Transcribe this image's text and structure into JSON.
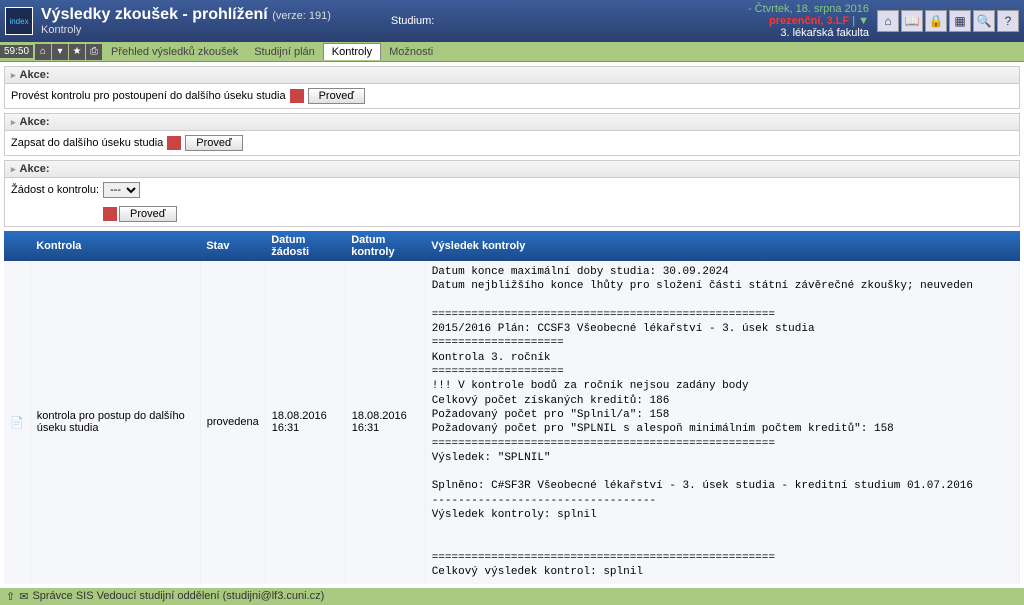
{
  "header": {
    "title": "Výsledky zkoušek - prohlížení",
    "version": "(verze: 191)",
    "subtitle": "Kontroly",
    "studium_label": "Studium:",
    "date": "- Čtvrtek, 18. srpna 2016",
    "context": "prezenční, 3.LF",
    "faculty": "3. lékařská fakulta"
  },
  "menubar": {
    "time": "59:50",
    "items": [
      {
        "label": "Přehled výsledků zkoušek",
        "active": false
      },
      {
        "label": "Studijní plán",
        "active": false
      },
      {
        "label": "Kontroly",
        "active": true
      },
      {
        "label": "Možnosti",
        "active": false
      }
    ]
  },
  "panels": {
    "a1": {
      "header": "Akce:",
      "text": "Provést kontrolu pro postoupení do dalšího úseku studia",
      "button": "Proveď"
    },
    "a2": {
      "header": "Akce:",
      "text": "Zapsat do dalšího úseku studia",
      "button": "Proveď"
    },
    "a3": {
      "header": "Akce:",
      "label": "Žádost o kontrolu:",
      "select_value": "---",
      "button": "Proveď"
    }
  },
  "table": {
    "headers": {
      "c1": "Kontrola",
      "c2": "Stav",
      "c3": "Datum žádosti",
      "c4": "Datum kontroly",
      "c5": "Výsledek kontroly"
    },
    "row": {
      "kontrola": "kontrola pro postup do dalšího úseku studia",
      "stav": "provedena",
      "datum_zadosti": "18.08.2016 16:31",
      "datum_kontroly": "18.08.2016 16:31",
      "vysledek": "Datum konce maximální doby studia: 30.09.2024\nDatum nejbližšího konce lhůty pro složení části státní závěrečné zkoušky; neuveden\n\n====================================================\n2015/2016 Plán: CCSF3 Všeobecné lékařství - 3. úsek studia\n====================\nKontrola 3. ročník\n====================\n!!! V kontrole bodů za ročník nejsou zadány body\nCelkový počet získaných kreditů: 186\nPožadovaný počet pro \"Splnil/a\": 158\nPožadovaný počet pro \"SPLNIL s alespoň minimálním počtem kreditů\": 158\n====================================================\nVýsledek: \"SPLNIL\"\n\nSplněno: C#SF3R Všeobecné lékařství - 3. úsek studia - kreditní studium 01.07.2016\n----------------------------------\nVýsledek kontroly: splnil\n\n\n====================================================\nCelkový výsledek kontrol: splnil"
    }
  },
  "footer": {
    "text": "Správce SIS  Vedoucí studijní oddělení (studijni@lf3.cuni.cz)"
  }
}
